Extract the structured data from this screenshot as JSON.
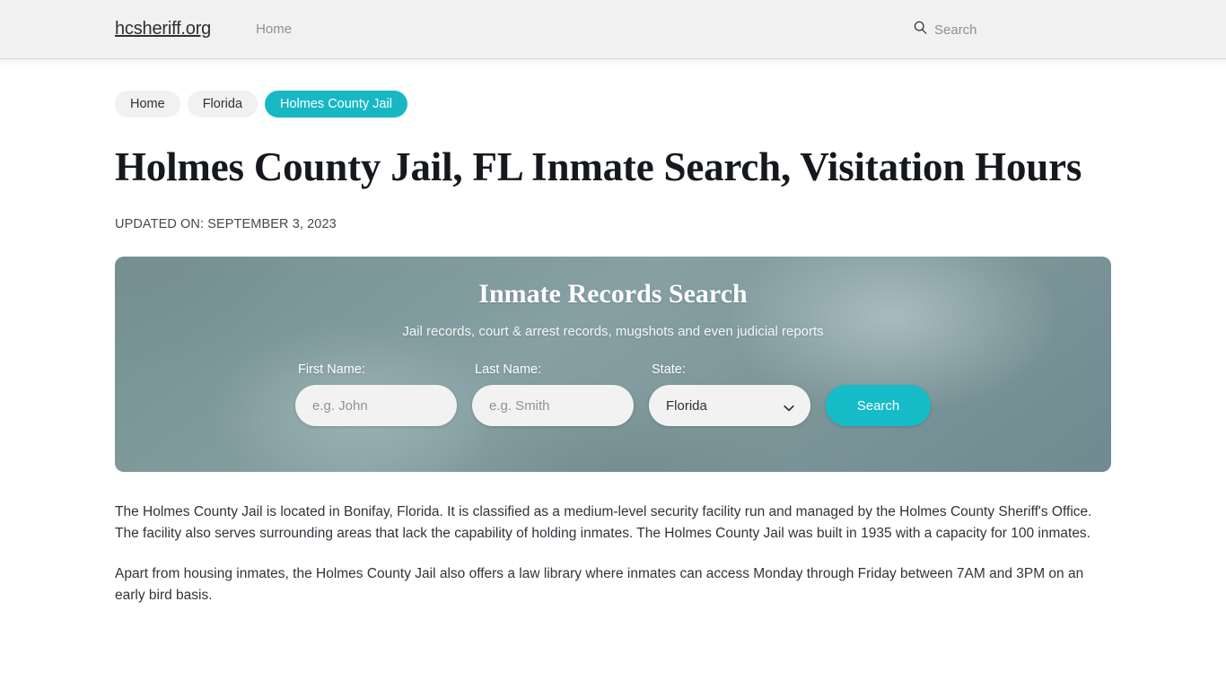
{
  "navbar": {
    "brand": "hcsheriff.org",
    "links": [
      {
        "label": "Home",
        "name": "nav-link-home"
      }
    ],
    "search": {
      "icon": "search-icon",
      "label": "Search"
    }
  },
  "breadcrumbs": [
    {
      "label": "Home",
      "current": false
    },
    {
      "label": "Florida",
      "current": false
    },
    {
      "label": "Holmes County Jail",
      "current": true
    }
  ],
  "article_header": {
    "title": "Holmes County Jail, FL Inmate Search, Visitation Hours",
    "updated": "UPDATED ON: SEPTEMBER 3, 2023"
  },
  "search_widget": {
    "title": "Inmate Records Search",
    "subtitle": "Jail records, court & arrest records, mugshots and even judicial reports",
    "fields": {
      "first_name": {
        "label": "First Name:",
        "placeholder": "e.g. John",
        "value": ""
      },
      "last_name": {
        "label": "Last Name:",
        "placeholder": "e.g. Smith",
        "value": ""
      },
      "state": {
        "label": "State:",
        "selected": "Florida",
        "chevron_icon": "chevron-down-icon"
      }
    },
    "submit_label": "Search"
  },
  "article_body": {
    "paragraphs": [
      "The Holmes County Jail is located in Bonifay, Florida. It is classified as a medium-level security facility run and managed by the Holmes County Sheriff's Office. The facility also serves surrounding areas that lack the capability of holding inmates. The Holmes County Jail was built in 1935 with a capacity for 100 inmates.",
      "Apart from housing inmates, the Holmes County Jail also offers a law library where inmates can access Monday through Friday between 7AM and 3PM on an early bird basis."
    ]
  },
  "colors": {
    "accent_teal": "#17b8c4",
    "navbar_bg": "#f1f1f1",
    "widget_bg": "#7d9699",
    "text_dark": "#2f343a"
  }
}
